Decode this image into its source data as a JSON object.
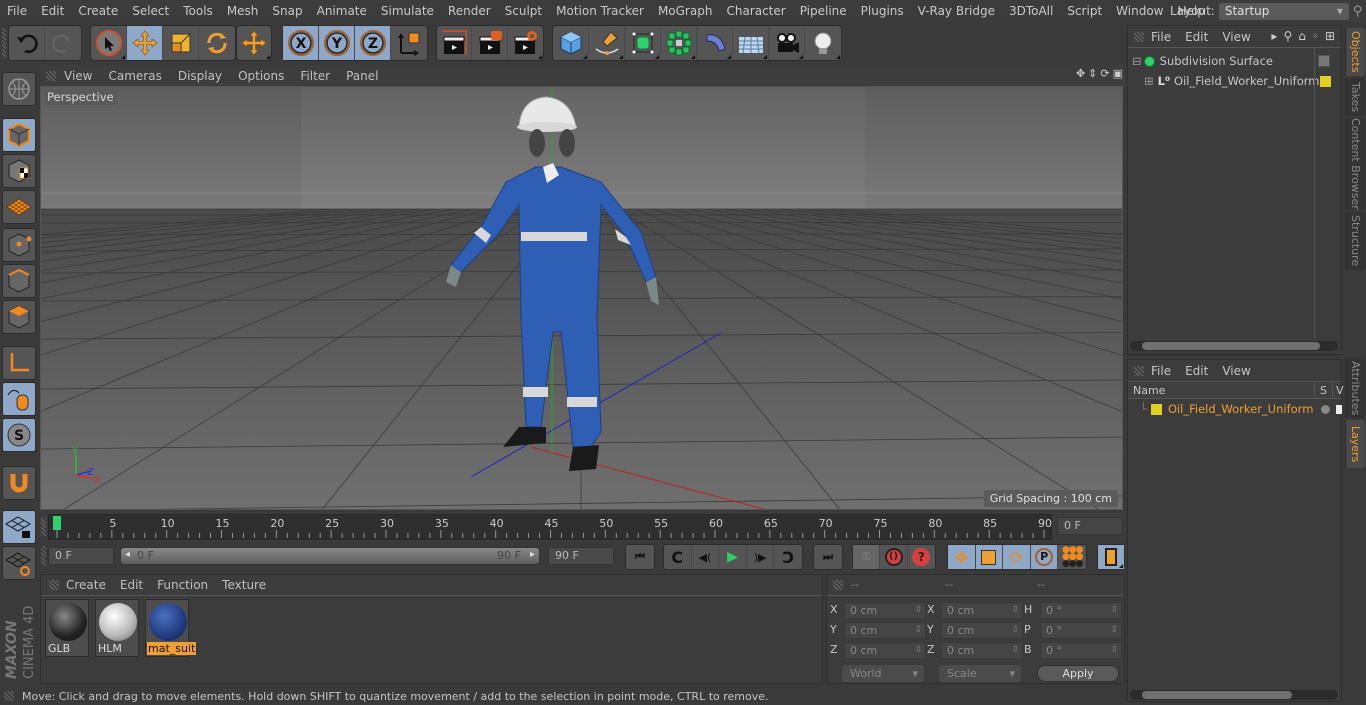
{
  "menubar": {
    "items": [
      "File",
      "Edit",
      "Create",
      "Select",
      "Tools",
      "Mesh",
      "Snap",
      "Animate",
      "Simulate",
      "Render",
      "Sculpt",
      "Motion Tracker",
      "MoGraph",
      "Character",
      "Pipeline",
      "Plugins",
      "V-Ray Bridge",
      "3DToAll",
      "Script",
      "Window",
      "Help"
    ],
    "layout_label": "Layout:",
    "layout_value": "Startup"
  },
  "toolbar": {
    "undo": "undo-icon",
    "redo": "redo-icon",
    "tools": [
      "live-selection",
      "move",
      "scale",
      "rotate",
      "last-used-tool"
    ],
    "axis": [
      "X",
      "Y",
      "Z"
    ],
    "coord_system": "world-coordinate-system",
    "render": [
      "render-view",
      "render-to-picture-viewer",
      "edit-render-settings"
    ],
    "objects": [
      "cube",
      "pen-spline",
      "subdivision-surface",
      "array-cloner",
      "bend-deformer",
      "floor-environment",
      "camera",
      "light"
    ]
  },
  "viewport": {
    "menu": [
      "View",
      "Cameras",
      "Display",
      "Options",
      "Filter",
      "Panel"
    ],
    "label": "Perspective",
    "grid_spacing": "Grid Spacing : 100 cm",
    "axis_labels": [
      "Y",
      "Z",
      "X"
    ]
  },
  "timeline": {
    "ticks": [
      "0",
      "5",
      "10",
      "15",
      "20",
      "25",
      "30",
      "35",
      "40",
      "45",
      "50",
      "55",
      "60",
      "65",
      "70",
      "75",
      "80",
      "85",
      "90"
    ],
    "current_frame_field": "0 F",
    "start_field": "0 F",
    "range_start": "0 F",
    "range_end": "90 F",
    "end_field": "90 F",
    "current_frame": 0,
    "max_frame": 90
  },
  "materials": {
    "menu": [
      "Create",
      "Edit",
      "Function",
      "Texture"
    ],
    "items": [
      {
        "name": "GLB",
        "selected": false
      },
      {
        "name": "HLM",
        "selected": false
      },
      {
        "name": "mat_suit",
        "selected": true
      }
    ]
  },
  "coordinates": {
    "headers": [
      "--",
      "--",
      "--"
    ],
    "rows": [
      {
        "l1": "X",
        "v1": "0 cm",
        "l2": "X",
        "v2": "0 cm",
        "l3": "H",
        "v3": "0 °"
      },
      {
        "l1": "Y",
        "v1": "0 cm",
        "l2": "Y",
        "v2": "0 cm",
        "l3": "P",
        "v3": "0 °"
      },
      {
        "l1": "Z",
        "v1": "0 cm",
        "l2": "Z",
        "v2": "0 cm",
        "l3": "B",
        "v3": "0 °"
      }
    ],
    "mode": "World",
    "size_mode": "Scale",
    "apply": "Apply"
  },
  "status": "Move: Click and drag to move elements. Hold down SHIFT to quantize movement / add to the selection in point mode, CTRL to remove.",
  "object_manager": {
    "menu": [
      "File",
      "Edit",
      "View"
    ],
    "objects": [
      {
        "name": "Subdivision Surface",
        "level": 0
      },
      {
        "name": "Oil_Field_Worker_Uniform",
        "level": 1,
        "layer_color": "#e0d020"
      }
    ]
  },
  "layer_manager": {
    "menu": [
      "File",
      "Edit",
      "View"
    ],
    "col_name": "Name",
    "col_s": "S",
    "col_v": "V",
    "layers": [
      {
        "name": "Oil_Field_Worker_Uniform",
        "color": "#e0d020"
      }
    ]
  },
  "side_tabs_top": [
    {
      "label": "Objects",
      "active": true
    },
    {
      "label": "Takes",
      "active": false
    },
    {
      "label": "Content Browser",
      "active": false
    },
    {
      "label": "Structure",
      "active": false
    }
  ],
  "side_tabs_bottom": [
    {
      "label": "Attributes",
      "active": false
    },
    {
      "label": "Layers",
      "active": true
    }
  ],
  "brand": {
    "line1": "MAXON",
    "line2": "CINEMA 4D"
  },
  "colors": {
    "accent_orange": "#f0a030",
    "active_blue": "#8fa8c8",
    "layer_yellow": "#e0d020"
  }
}
